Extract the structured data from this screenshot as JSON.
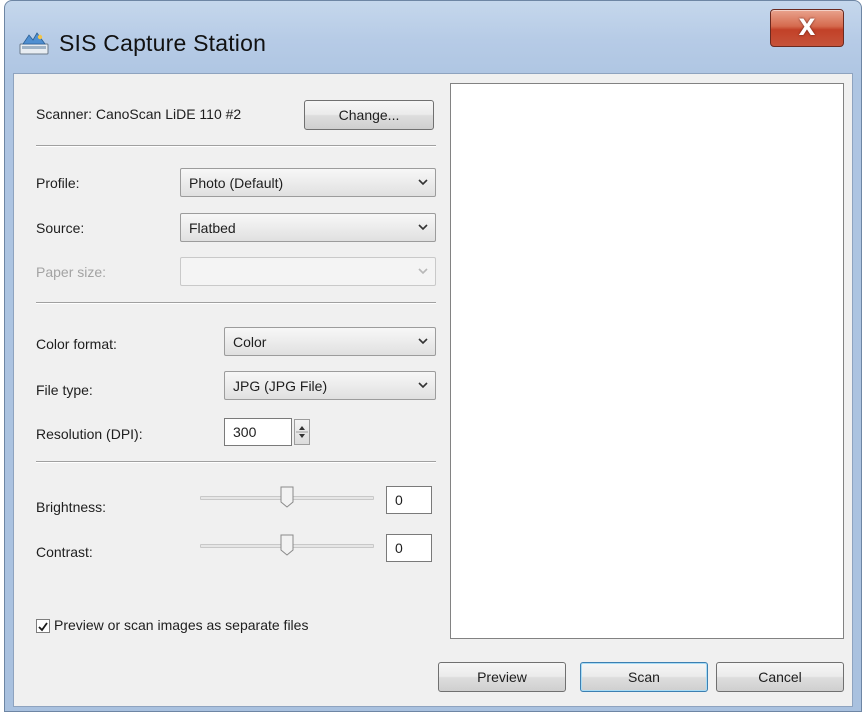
{
  "window": {
    "title": "SIS Capture Station",
    "close_glyph": "X",
    "close_icon": "close-icon"
  },
  "scanner": {
    "label": "Scanner: CanoScan LiDE 110 #2",
    "change_button": "Change..."
  },
  "profile": {
    "label": "Profile:",
    "value": "Photo (Default)"
  },
  "source": {
    "label": "Source:",
    "value": "Flatbed"
  },
  "paper_size": {
    "label": "Paper size:",
    "value": "",
    "enabled": false
  },
  "color_format": {
    "label": "Color format:",
    "value": "Color"
  },
  "file_type": {
    "label": "File type:",
    "value": "JPG (JPG File)"
  },
  "resolution": {
    "label": "Resolution (DPI):",
    "value": "300"
  },
  "brightness": {
    "label": "Brightness:",
    "value": "0",
    "slider_fraction": 0.5
  },
  "contrast": {
    "label": "Contrast:",
    "value": "0",
    "slider_fraction": 0.5
  },
  "separate_files": {
    "label": "Preview or scan images as separate files",
    "checked": true
  },
  "buttons": {
    "preview": "Preview",
    "scan": "Scan",
    "cancel": "Cancel"
  },
  "colors": {
    "titlebar": "#b6cbe6",
    "close_button": "#c24128",
    "dialog_background": "#f0f0f0",
    "default_button_border": "#3c7fb1"
  }
}
